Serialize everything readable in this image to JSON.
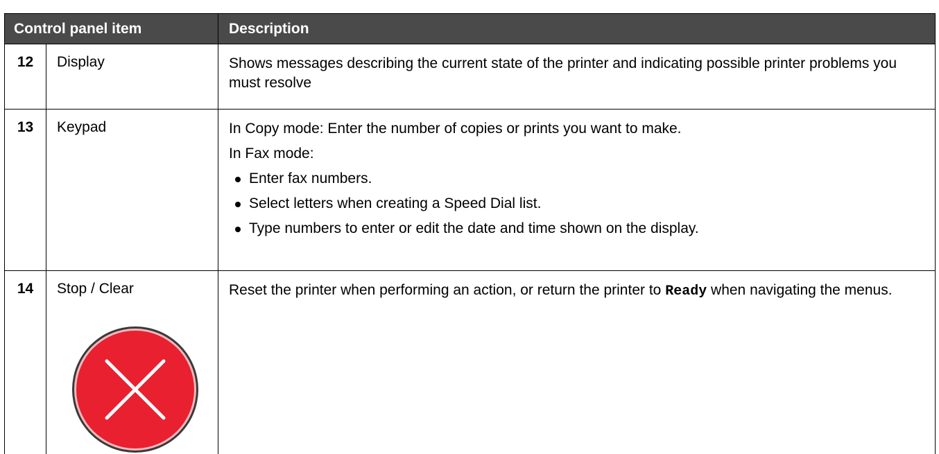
{
  "table": {
    "headers": {
      "control_panel_item": "Control panel item",
      "description": "Description"
    },
    "rows": [
      {
        "number": "12",
        "item": "Display",
        "description": "Shows messages describing the current state of the printer and indicating possible printer problems you must resolve"
      },
      {
        "number": "13",
        "item": "Keypad",
        "description_copy": "In Copy mode: Enter the number of copies or prints you want to make.",
        "description_fax_intro": "In Fax mode:",
        "bullets": [
          "Enter fax numbers.",
          "Select letters when creating a Speed Dial list.",
          "Type numbers to enter or edit the date and time shown on the display."
        ]
      },
      {
        "number": "14",
        "item": "Stop / Clear",
        "description_before": "Reset the printer when performing an action, or return the printer to ",
        "description_code": "Ready",
        "description_after": " when navigating the menus.",
        "icon": "stop-clear-icon"
      }
    ]
  },
  "colors": {
    "header_background": "#4a4a4a",
    "header_text": "#ffffff",
    "stop_button_red": "#e8202f",
    "border": "#000000"
  }
}
